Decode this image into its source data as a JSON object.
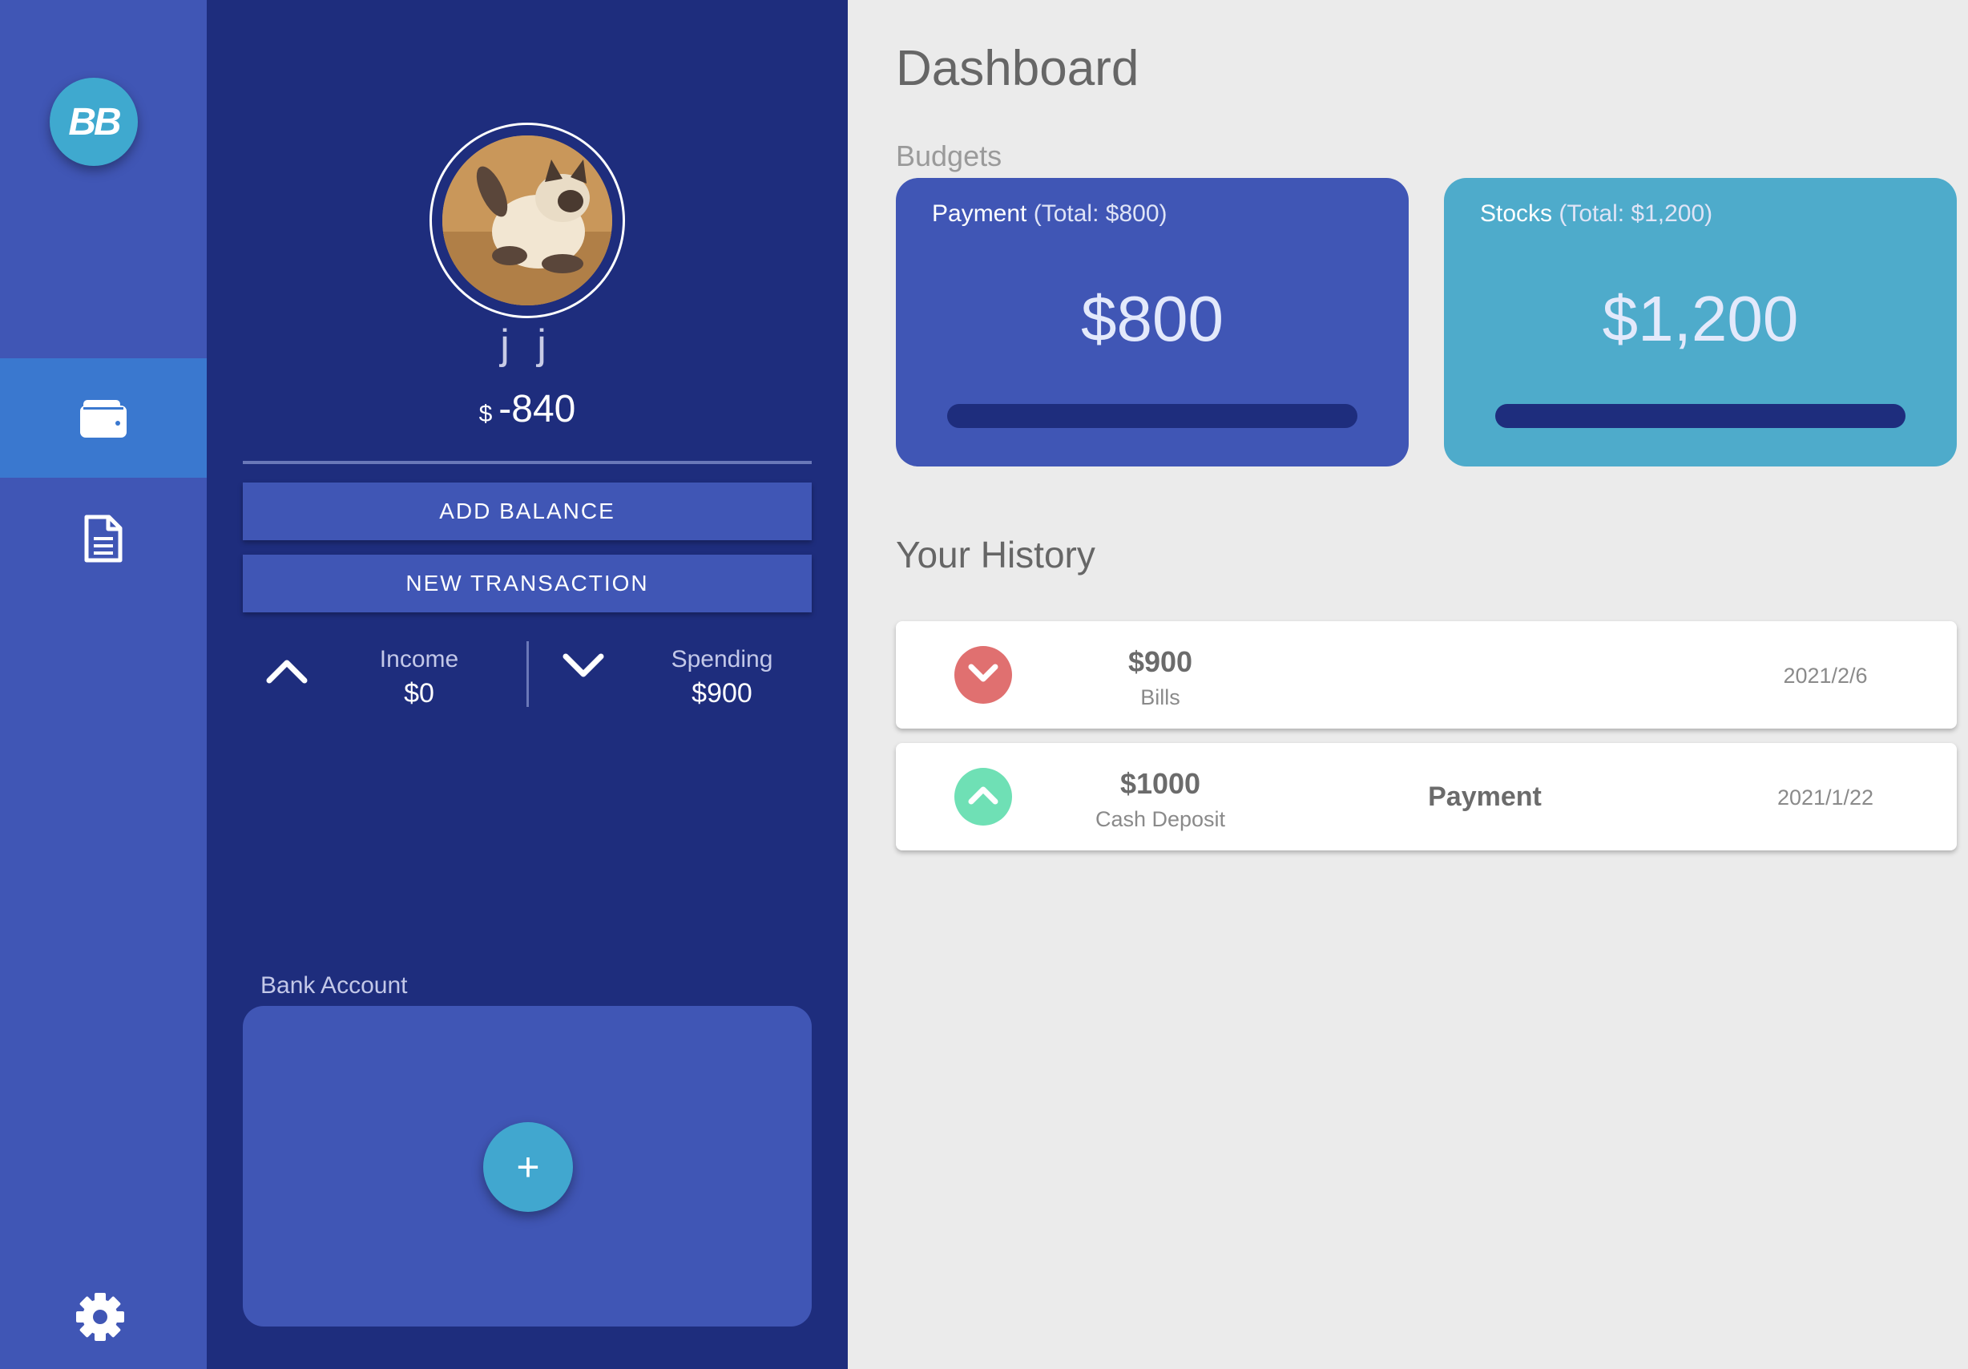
{
  "app": {
    "logo_text": "BB"
  },
  "rail": {
    "items": [
      {
        "icon": "wallet-icon",
        "active": true
      },
      {
        "icon": "document-icon",
        "active": false
      }
    ],
    "settings_icon": "gear-icon"
  },
  "profile": {
    "username": "j j",
    "balance_currency": "$",
    "balance_value": "-840",
    "add_balance_label": "ADD BALANCE",
    "new_transaction_label": "NEW TRANSACTION",
    "income_label": "Income",
    "income_value": "$0",
    "spending_label": "Spending",
    "spending_value": "$900",
    "bank_account_label": "Bank Account",
    "bank_add_label": "+"
  },
  "dashboard": {
    "title": "Dashboard",
    "budgets_label": "Budgets",
    "budgets": [
      {
        "name": "Payment",
        "total_text": "(Total: $800)",
        "amount": "$800",
        "progress": 1.0,
        "color": "#4056b5"
      },
      {
        "name": "Stocks",
        "total_text": "(Total: $1,200)",
        "amount": "$1,200",
        "progress": 1.0,
        "color": "#4eabcb"
      }
    ],
    "history_title": "Your History",
    "history": [
      {
        "direction": "down",
        "icon": "chevron-down-icon",
        "icon_color": "#e07070",
        "amount": "$900",
        "category": "Bills",
        "budget": "",
        "date": "2021/2/6"
      },
      {
        "direction": "up",
        "icon": "chevron-up-icon",
        "icon_color": "#6fe0b5",
        "amount": "$1000",
        "category": "Cash Deposit",
        "budget": "Payment",
        "date": "2021/1/22"
      }
    ]
  },
  "colors": {
    "rail_bg": "#4056b5",
    "rail_active": "#3a78cf",
    "panel_bg": "#1e2d7d",
    "main_bg": "#ebebeb",
    "accent_cyan": "#41a7cf"
  }
}
